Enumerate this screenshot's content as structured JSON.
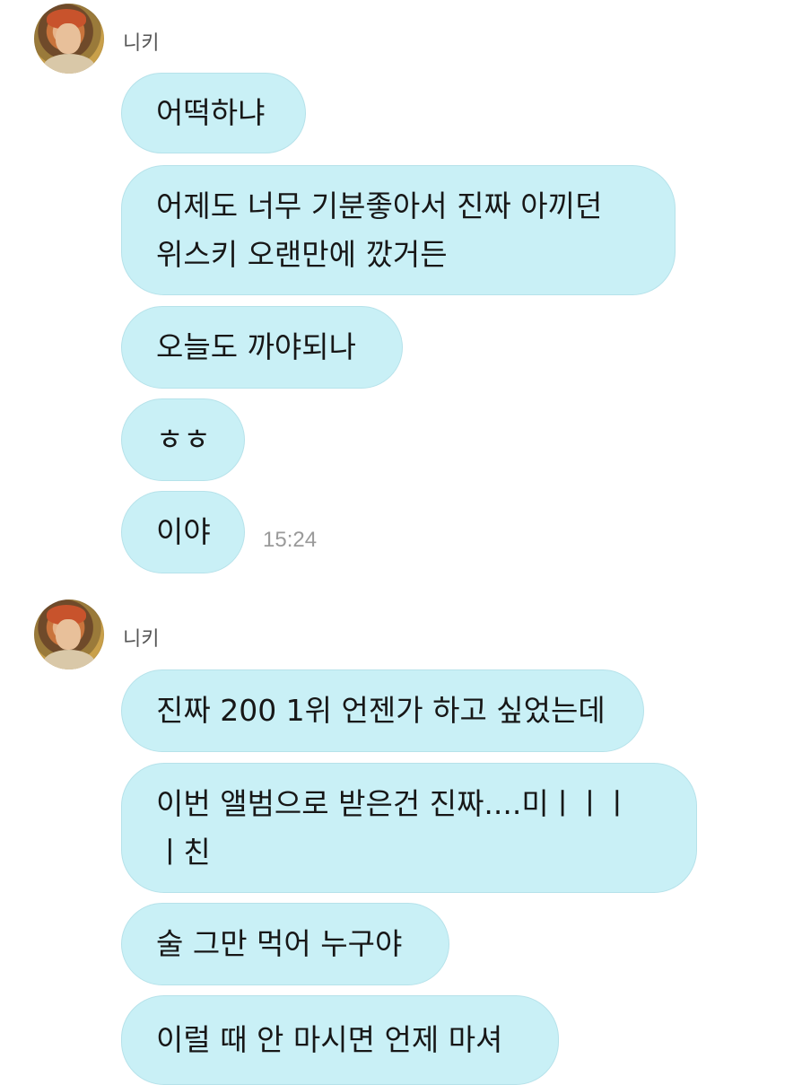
{
  "chat": {
    "groups": [
      {
        "sender": "니키",
        "avatar_icon": "profile-photo",
        "messages": [
          {
            "lines": [
              "어떡하냐"
            ]
          },
          {
            "lines": [
              "어제도 너무 기분좋아서 진짜 아끼던",
              "위스키 오랜만에 깠거든"
            ]
          },
          {
            "lines": [
              "오늘도 까야되나"
            ]
          },
          {
            "lines": [
              "ㅎㅎ"
            ]
          },
          {
            "lines": [
              "이야"
            ]
          }
        ],
        "timestamp": "15:24"
      },
      {
        "sender": "니키",
        "avatar_icon": "profile-photo",
        "messages": [
          {
            "lines": [
              "진짜 200 1위 언젠가 하고 싶었는데"
            ]
          },
          {
            "lines": [
              "이번 앨범으로 받은건 진짜....미ㅣㅣㅣ",
              "ㅣ친"
            ]
          },
          {
            "lines": [
              "술 그만 먹어 누구야"
            ]
          },
          {
            "lines": [
              "이럴 때 안 마시면 언제 마셔"
            ]
          }
        ]
      }
    ]
  },
  "colors": {
    "bubble": "#c9f0f6",
    "bubble_border": "#b6e2ea",
    "sender_name": "#555555",
    "timestamp": "#9a9a9a"
  }
}
